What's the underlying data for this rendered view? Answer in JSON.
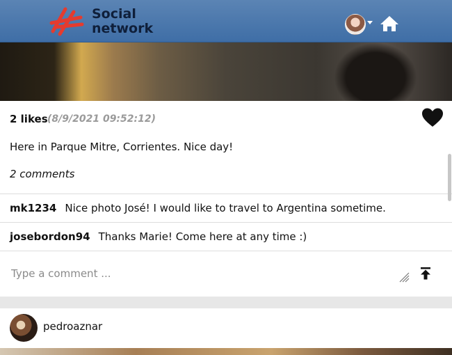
{
  "header": {
    "brand_line1": "Social",
    "brand_line2": "network"
  },
  "post": {
    "likes": "2 likes",
    "timestamp": "(8/9/2021 09:52:12)",
    "caption": "Here in Parque Mitre, Corrientes. Nice day!",
    "comments_count": "2 comments",
    "comments": [
      {
        "user": "mk1234",
        "text": "Nice photo José! I would like to travel to Argentina sometime."
      },
      {
        "user": "josebordon94",
        "text": "Thanks Marie! Come here at any time :)"
      }
    ],
    "comment_input": {
      "placeholder": "Type a comment ..."
    }
  },
  "next_post": {
    "username": "pedroaznar"
  },
  "icons": {
    "heart": "heart-icon",
    "send": "send-arrow-up-icon",
    "home": "home-icon",
    "resize": "resize-grip-icon"
  },
  "colors": {
    "header": "#4a76ab",
    "logo_accent": "#e53b2e"
  }
}
